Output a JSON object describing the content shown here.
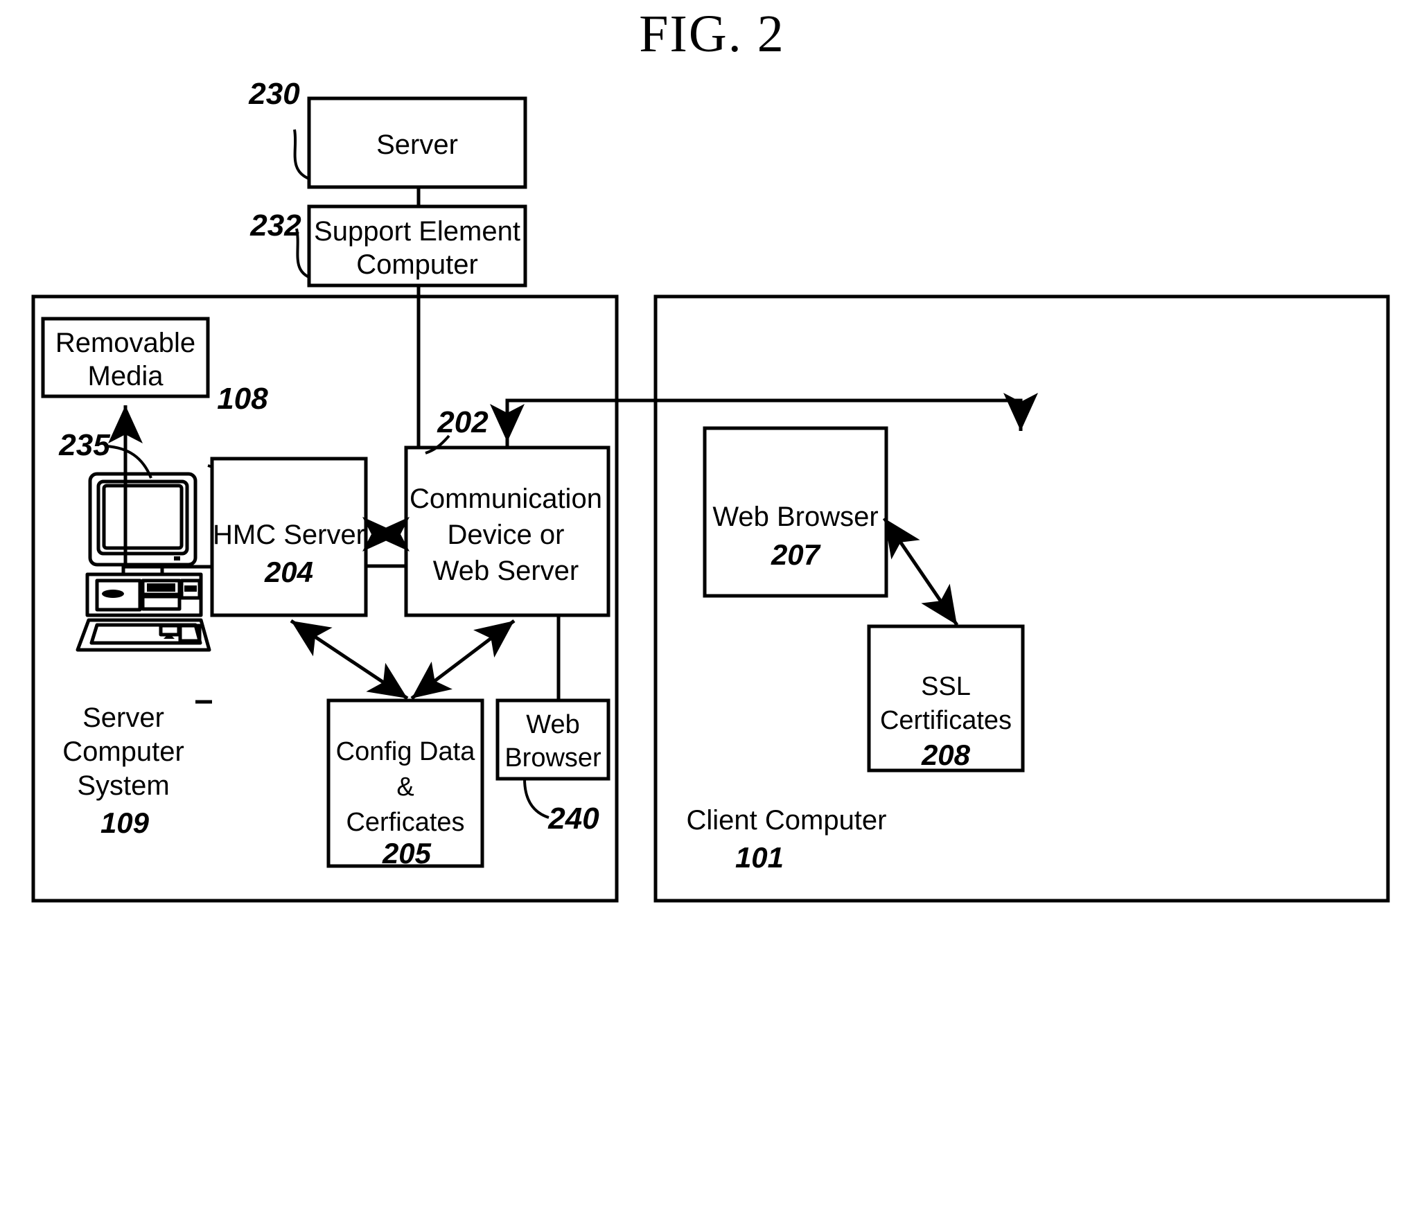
{
  "figure": {
    "title": "FIG. 2"
  },
  "nodes": {
    "server": {
      "label": "Server",
      "ref": "230"
    },
    "support_element": {
      "label_line1": "Support Element",
      "label_line2": "Computer",
      "ref": "232"
    },
    "removable_media": {
      "label_line1": "Removable",
      "label_line2": "Media",
      "ref": "108"
    },
    "workstation": {
      "ref": "235",
      "icon": "desktop-computer-icon"
    },
    "hmc_server": {
      "label": "HMC Server",
      "ref": "204"
    },
    "comm_device": {
      "label_line1": "Communication",
      "label_line2": "Device or",
      "label_line3": "Web Server",
      "ref": "202"
    },
    "config_data": {
      "label_line1": "Config Data",
      "label_line2": "&",
      "label_line3": "Cerficates",
      "ref": "205"
    },
    "web_browser_server": {
      "label_line1": "Web",
      "label_line2": "Browser",
      "ref": "240"
    },
    "web_browser_client": {
      "label": "Web Browser",
      "ref": "207"
    },
    "ssl_certificates": {
      "label_line1": "SSL",
      "label_line2": "Certificates",
      "ref": "208"
    }
  },
  "containers": {
    "server_computer_system": {
      "label_line1": "Server",
      "label_line2": "Computer",
      "label_line3": "System",
      "ref": "109"
    },
    "client_computer": {
      "label": "Client Computer",
      "ref": "101"
    }
  },
  "colors": {
    "line": "#000000",
    "background": "#ffffff",
    "text": "#000000"
  }
}
